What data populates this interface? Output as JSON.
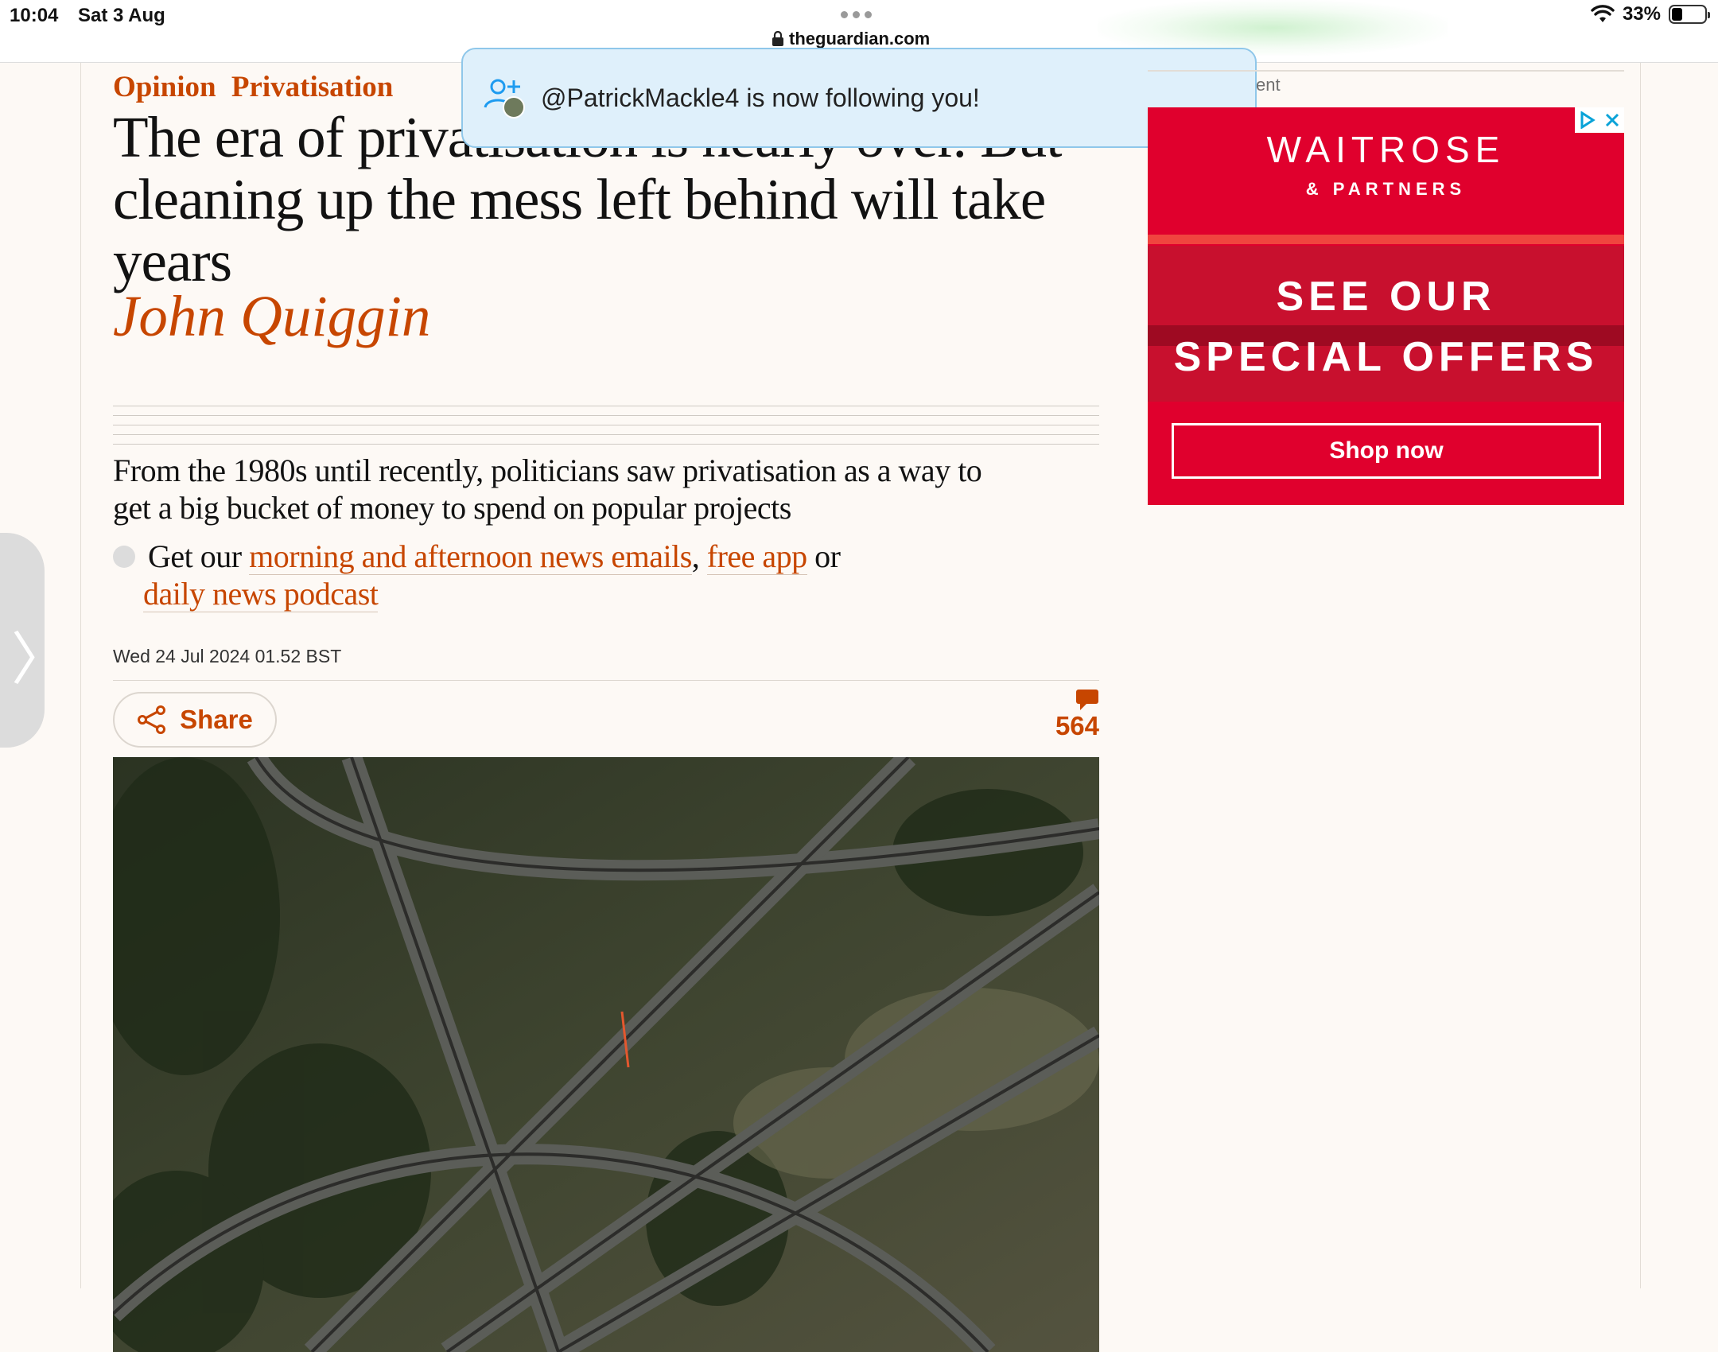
{
  "status_bar": {
    "time": "10:04",
    "date": "Sat 3 Aug",
    "url": "theguardian.com",
    "battery": "33%"
  },
  "article": {
    "section": "Opinion",
    "series": "Privatisation",
    "headline": "The era of privatisation is nearly over. But cleaning up the mess left behind will take years",
    "author": "John Quiggin",
    "standfirst": "From the 1980s until recently, politicians saw privatisation as a way to get a big bucket of money to spend on popular projects",
    "promo": {
      "prefix": "Get our ",
      "link1": "morning and afternoon news emails",
      "sep": ", ",
      "link2": "free app",
      "mid": " or",
      "link3": "daily news podcast"
    },
    "date": "Wed 24 Jul 2024 01.52 BST",
    "share_label": "Share",
    "comment_count": "564"
  },
  "notification": {
    "message": "@PatrickMackle4 is now following you!"
  },
  "advert": {
    "label": "ent",
    "brand": "WAITROSE",
    "sub_brand": "& PARTNERS",
    "line1": "SEE OUR",
    "line2": "SPECIAL OFFERS",
    "cta": "Shop now"
  },
  "colors": {
    "accent": "#c74600",
    "opinion": "#c70000",
    "ad_red": "#e0002d"
  }
}
